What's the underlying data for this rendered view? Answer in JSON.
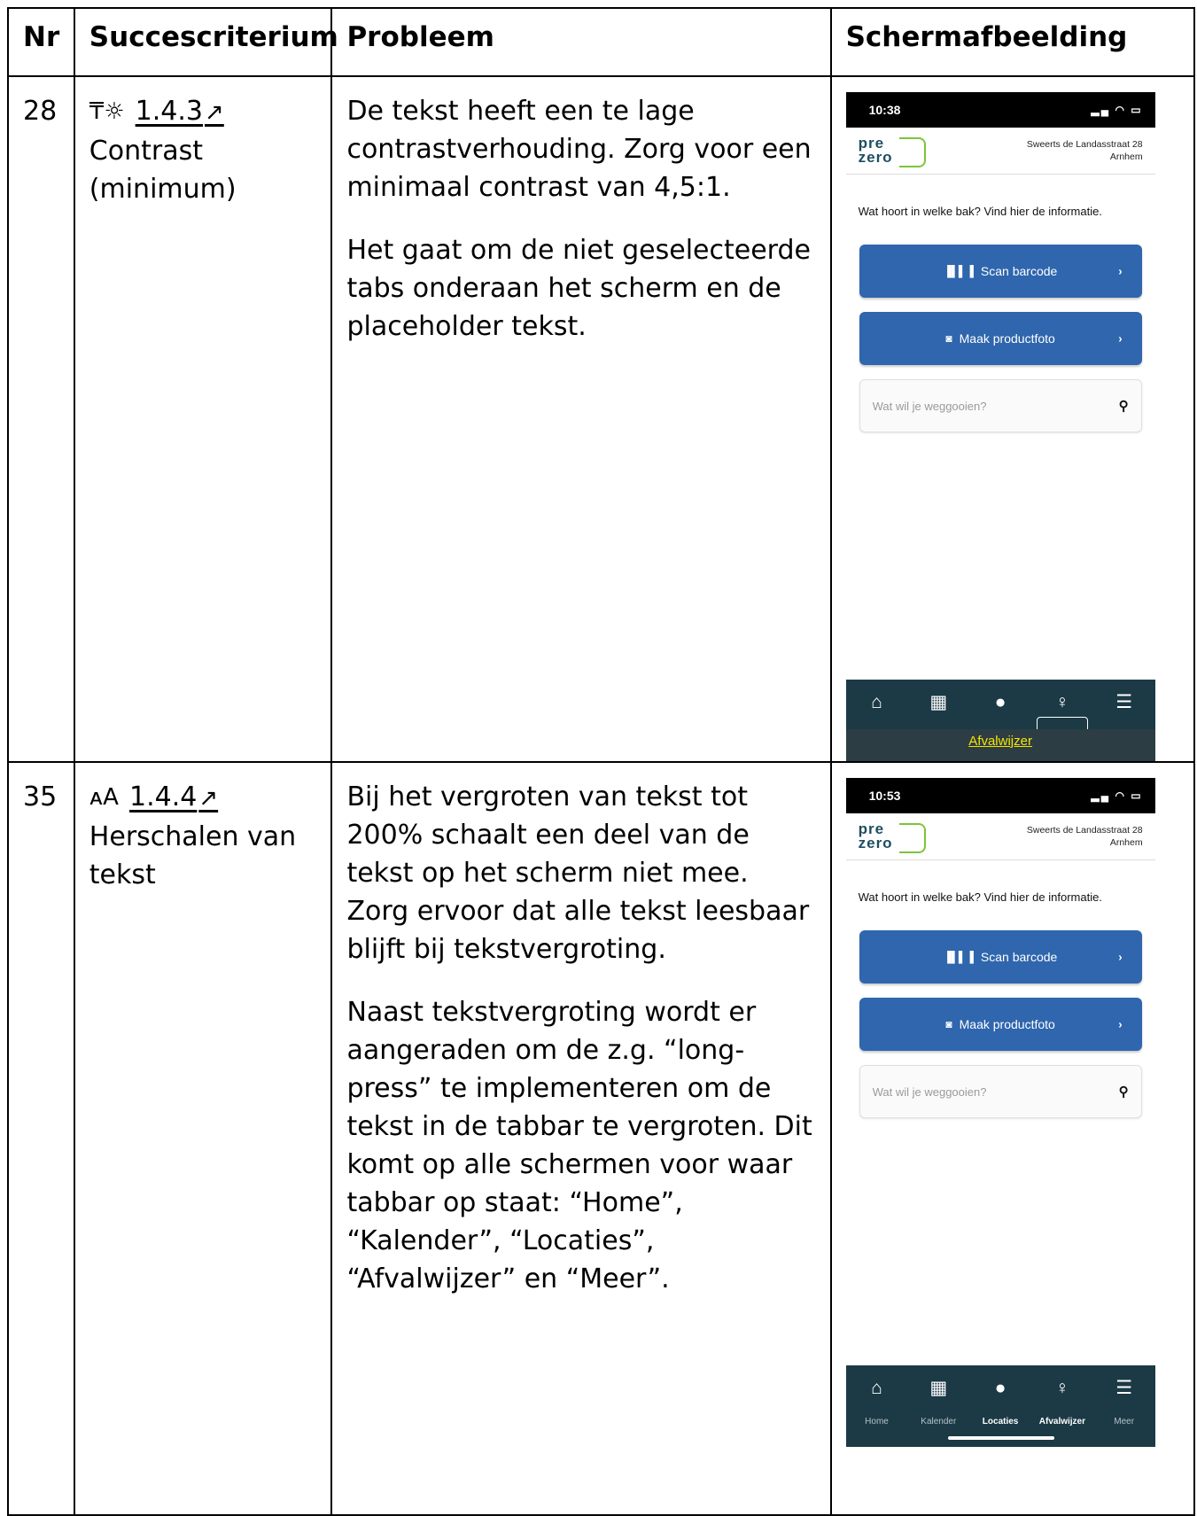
{
  "table": {
    "headers": [
      "Nr",
      "Succescriterium",
      "Probleem",
      "Schermafbeelding"
    ]
  },
  "rows": [
    {
      "nr": "28",
      "criterion": {
        "icon": "contrast-icon",
        "icon_glyph": "₸☼",
        "number": "1.4.3",
        "name": "Contrast (minimum)"
      },
      "problem": [
        "De tekst heeft een te lage contrastverhouding. Zorg voor een minimaal contrast van 4,5:1.",
        "Het gaat om de niet geselecteerde tabs onderaan het scherm en de placeholder tekst."
      ],
      "screenshot": {
        "time": "10:38",
        "address_line1": "Sweerts de Landasstraat 28",
        "address_line2": "Arnhem",
        "question": "Wat hoort in welke bak? Vind hier de informatie.",
        "btn_scan": "Scan barcode",
        "btn_photo": "Maak productfoto",
        "search_placeholder": "Wat wil je weggooien?",
        "tooltip": "Afvalwijzer"
      }
    },
    {
      "nr": "35",
      "criterion": {
        "icon": "text-resize-icon",
        "icon_glyph": "ᴀA",
        "number": "1.4.4",
        "name": "Herschalen van tekst"
      },
      "problem": [
        "Bij het vergroten van tekst tot 200% schaalt een deel van de tekst op het scherm niet mee. Zorg ervoor dat alle tekst leesbaar blijft bij tekstvergroting.",
        "Naast tekstvergroting wordt er aangeraden om de z.g. “long-press” te implementeren om de tekst in de tabbar te vergroten. Dit komt op alle schermen voor waar tabbar op staat: “Home”, “Kalender”, “Locaties”, “Afvalwijzer” en “Meer”."
      ],
      "screenshot": {
        "time": "10:53",
        "address_line1": "Sweerts de Landasstraat 28",
        "address_line2": "Arnhem",
        "question": "Wat hoort in welke bak? Vind hier de informatie.",
        "btn_scan": "Scan barcode",
        "btn_photo": "Maak productfoto",
        "search_placeholder": "Wat wil je weggooien?"
      }
    }
  ],
  "app": {
    "logo_top": "pre",
    "logo_bottom": "zero",
    "tabs": [
      "Home",
      "Kalender",
      "Locaties",
      "Afvalwijzer",
      "Meer"
    ],
    "status_icons": "▂▄ ◠ ▭"
  },
  "colors": {
    "button_blue": "#2f66ad",
    "tabbar": "#1b3a45",
    "logo_green": "#7cc53a",
    "tooltip_text": "#f6e400"
  }
}
